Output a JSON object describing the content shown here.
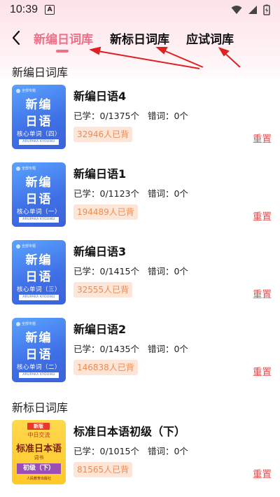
{
  "status": {
    "time": "10:39",
    "notification_letter": "A"
  },
  "tabs": [
    {
      "label": "新编日词库",
      "active": true
    },
    {
      "label": "新标日词库",
      "active": false
    },
    {
      "label": "应试词库",
      "active": false
    }
  ],
  "sections": [
    {
      "title": "新编日词库",
      "books": [
        {
          "name": "新编日语4",
          "learned_label": "已学：0/1375个",
          "wrong_label": "错词：0个",
          "count_label": "32946人已背",
          "reset_label": "重置",
          "cover": {
            "badge": "全部专题",
            "line1": "新编",
            "line2": "日语",
            "subtitle": "核心单词（四）",
            "foot": "ARUPAKA KYOUIKU"
          }
        },
        {
          "name": "新编日语1",
          "learned_label": "已学：0/1123个",
          "wrong_label": "错词：0个",
          "count_label": "194489人已背",
          "reset_label": "重置",
          "cover": {
            "badge": "全部专题",
            "line1": "新编",
            "line2": "日语",
            "subtitle": "核心单词（一）",
            "foot": "ARUPAKA KYOUIKU"
          }
        },
        {
          "name": "新编日语3",
          "learned_label": "已学：0/1415个",
          "wrong_label": "错词：0个",
          "count_label": "32555人已背",
          "reset_label": "重置",
          "cover": {
            "badge": "全部专题",
            "line1": "新编",
            "line2": "日语",
            "subtitle": "核心单词（三）",
            "foot": "ARUPAKA KYOUIKU"
          }
        },
        {
          "name": "新编日语2",
          "learned_label": "已学：0/1435个",
          "wrong_label": "错词：0个",
          "count_label": "146838人已背",
          "reset_label": "重置",
          "cover": {
            "badge": "全部专题",
            "line1": "新编",
            "line2": "日语",
            "subtitle": "核心单词（二）",
            "foot": "ARUPAKA KYOUIKU"
          }
        }
      ]
    },
    {
      "title": "新标日词库",
      "books": [
        {
          "name": "标准日本语初级（下）",
          "learned_label": "已学：0/1015个",
          "wrong_label": "错词：0个",
          "count_label": "81565人已背",
          "reset_label": "重置",
          "cover": {
            "badge": "新版",
            "line1": "中日交流",
            "line2": "标准日本语",
            "line3": "词书",
            "line4": "初级（下）",
            "line5": "人民教育出版社"
          }
        }
      ]
    }
  ],
  "colors": {
    "accent": "#ef6f87",
    "reset": "#e84a4a",
    "count_bg": "#fde6d8",
    "count_text": "#f08a4e",
    "cover_blue": "#3f6fe6",
    "cover_yellow": "#ffc928",
    "annotation_arrow": "#e02020"
  }
}
